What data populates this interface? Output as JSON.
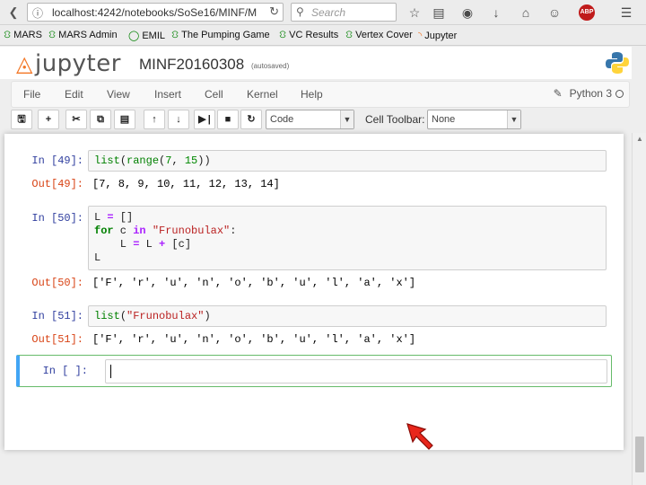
{
  "browser": {
    "url": "localhost:4242/notebooks/SoSe16/MINF/M",
    "search_placeholder": "Search",
    "bookmarks": [
      "MARS",
      "MARS Admin",
      "EMIL",
      "The Pumping Game",
      "VC Results",
      "Vertex Cover",
      "Jupyter"
    ],
    "adblock_label": "ABP"
  },
  "jupyter": {
    "logo_text": "jupyter",
    "notebook_name": "MINF20160308",
    "save_status": "(autosaved)",
    "menu": [
      "File",
      "Edit",
      "View",
      "Insert",
      "Cell",
      "Kernel",
      "Help"
    ],
    "kernel_name": "Python 3",
    "cell_type": "Code",
    "cell_toolbar_label": "Cell Toolbar:",
    "cell_toolbar_value": "None"
  },
  "cells": [
    {
      "in_prompt": "In [49]:",
      "code": "list(range(7, 15))",
      "out_prompt": "Out[49]:",
      "output": "[7, 8, 9, 10, 11, 12, 13, 14]"
    },
    {
      "in_prompt": "In [50]:",
      "code": "L = []\nfor c in \"Frunobulax\":\n    L = L + [c]\nL",
      "out_prompt": "Out[50]:",
      "output": "['F', 'r', 'u', 'n', 'o', 'b', 'u', 'l', 'a', 'x']"
    },
    {
      "in_prompt": "In [51]:",
      "code": "list(\"Frunobulax\")",
      "out_prompt": "Out[51]:",
      "output": "['F', 'r', 'u', 'n', 'o', 'b', 'u', 'l', 'a', 'x']"
    },
    {
      "in_prompt": "In [ ]:",
      "code": ""
    }
  ],
  "colors": {
    "accent_orange": "#f37726",
    "prompt_in": "#303f9f",
    "prompt_out": "#d84315",
    "cursor": "#e8261b"
  }
}
